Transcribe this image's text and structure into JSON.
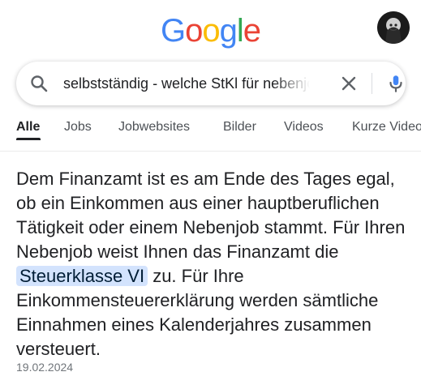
{
  "header": {
    "logo_letters": [
      "G",
      "o",
      "o",
      "g",
      "l",
      "e"
    ],
    "logo_colors": [
      "#4285F4",
      "#EA4335",
      "#FBBC05",
      "#4285F4",
      "#34A853",
      "#EA4335"
    ]
  },
  "search": {
    "query": "selbstständig - welche StKl für nebenjob",
    "icons": [
      "search-icon",
      "clear-icon",
      "mic-icon"
    ]
  },
  "tabs": [
    {
      "label": "Alle",
      "active": true
    },
    {
      "label": "Jobs",
      "active": false
    },
    {
      "label": "Jobwebsites",
      "active": false
    },
    {
      "label": "Bilder",
      "active": false
    },
    {
      "label": "Videos",
      "active": false
    },
    {
      "label": "Kurze Videos",
      "active": false
    }
  ],
  "snippet": {
    "text_before": "Dem Finanzamt ist es am Ende des Tages egal, ob ein Einkommen aus einer hauptberuflichen Tätigkeit oder einem Nebenjob stammt. Für Ihren Nebenjob weist Ihnen das Finanzamt die ",
    "highlight": "Steuerklasse VI",
    "text_after": " zu. Für Ihre Einkommensteuererklärung werden sämtliche Einnahmen eines Kalenderjahres zusammen versteuert.",
    "date": "19.02.2024",
    "highlight_color": "#d3e3fd"
  }
}
